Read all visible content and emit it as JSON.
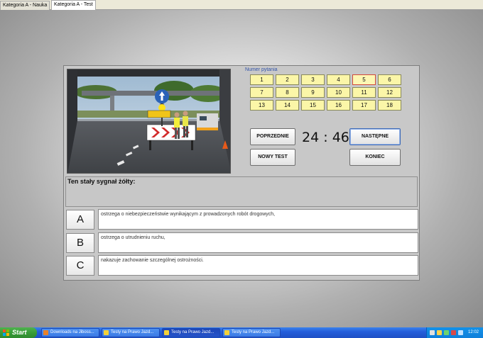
{
  "tabs": [
    {
      "label": "Kategoria A - Nauka"
    },
    {
      "label": "Kategoria A - Test"
    }
  ],
  "grid_label": "Numer pytania",
  "questions": [
    "1",
    "2",
    "3",
    "4",
    "5",
    "6",
    "7",
    "8",
    "9",
    "10",
    "11",
    "12",
    "13",
    "14",
    "15",
    "16",
    "17",
    "18"
  ],
  "current_question": "5",
  "timer": {
    "minutes": "24",
    "separator": ":",
    "seconds": "46"
  },
  "buttons": {
    "previous": "POPRZEDNIE",
    "next": "NASTĘPNE",
    "new_test": "NOWY TEST",
    "end": "KONIEC"
  },
  "question_text": "Ten stały sygnał żółty:",
  "answers": [
    {
      "letter": "A",
      "text": "ostrzega o niebezpieczeństwie wynikającym z prowadzonych robót drogowych,"
    },
    {
      "letter": "B",
      "text": "ostrzega o utrudnieniu ruchu,"
    },
    {
      "letter": "C",
      "text": "nakazuje zachowanie szczególnej ostrożności."
    }
  ],
  "taskbar": {
    "start": "Start",
    "items": [
      {
        "label": "Downloads na Jiboss...",
        "icon": "firefox-icon"
      },
      {
        "label": "Testy na Prawo Jazd...",
        "icon": "app-icon"
      },
      {
        "label": "Testy na Prawo Jazd...",
        "icon": "app-icon"
      },
      {
        "label": "Testy na Prawo Jazd...",
        "icon": "app-icon"
      }
    ],
    "clock": "12:02"
  },
  "colors": {
    "grid_button": "#fbf6a8",
    "current_border": "#d24a3a",
    "taskbar": "#245edb",
    "start": "#389c38"
  }
}
